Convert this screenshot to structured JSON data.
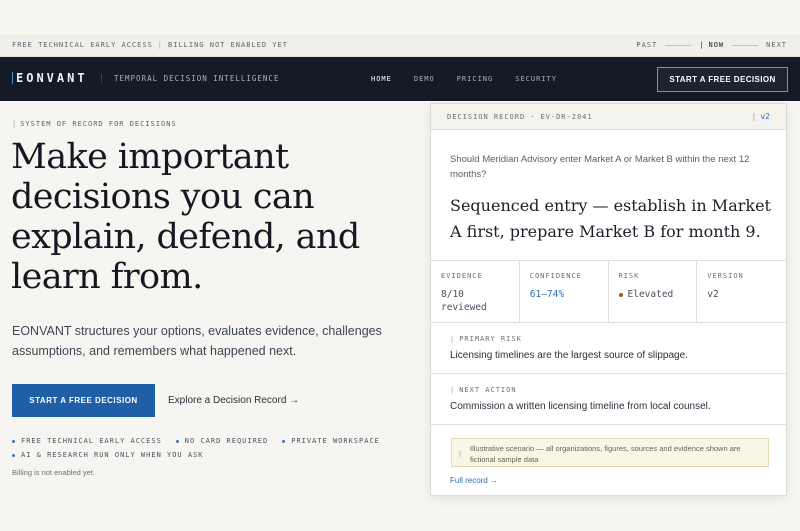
{
  "strip": {
    "left_items": [
      "FREE TECHNICAL EARLY ACCESS",
      "BILLING NOT ENABLED YET"
    ],
    "separator": "|",
    "timeline": {
      "past": "PAST",
      "now": "NOW",
      "next": "NEXT",
      "now_marker": "|"
    }
  },
  "nav": {
    "logo": "EONVANT",
    "tagline": "TEMPORAL DECISION INTELLIGENCE",
    "links": [
      "HOME",
      "DEMO",
      "PRICING",
      "SECURITY"
    ],
    "active_link": "HOME",
    "cta": "START A FREE DECISION"
  },
  "hero": {
    "eyebrow_marker": "|",
    "eyebrow": "SYSTEM OF RECORD FOR DECISIONS",
    "headline_lines": [
      "Make important",
      "decisions you can",
      "explain, defend, and",
      "learn from."
    ],
    "lede_lines": [
      "EONVANT structures your options, evaluates evidence, challenges",
      "assumptions, and remembers what happened next."
    ],
    "cta_primary": "START A FREE DECISION",
    "cta_secondary": "Explore a Decision Record →",
    "bullets_row1": [
      "FREE TECHNICAL EARLY ACCESS",
      "NO CARD REQUIRED",
      "PRIVATE WORKSPACE"
    ],
    "bullets_row2": [
      "AI & RESEARCH RUN ONLY WHEN YOU ASK"
    ],
    "billing_note": "Billing is not enabled yet."
  },
  "record": {
    "label": "DECISION RECORD",
    "separator": "·",
    "id": "EV-DR-2041",
    "version_marker": "|",
    "version_badge": "v2",
    "question": "Should Meridian Advisory enter Market A or Market B within the next 12 months?",
    "answer": "Sequenced entry — establish in Market A first, prepare Market B for month 9.",
    "stats": {
      "evidence": {
        "label": "EVIDENCE",
        "value_line1": "8/10",
        "value_line2": "reviewed"
      },
      "confidence": {
        "label": "CONFIDENCE",
        "value": "61–74%"
      },
      "risk": {
        "label": "RISK",
        "value": "Elevated",
        "color": "#a8522f"
      },
      "version": {
        "label": "VERSION",
        "value": "v2"
      }
    },
    "section_marker": "|",
    "primary_risk": {
      "label": "PRIMARY RISK",
      "text": "Licensing timelines are the largest source of slippage."
    },
    "next_action": {
      "label": "NEXT ACTION",
      "text": "Commission a written licensing timeline from local counsel."
    },
    "disclaimer_marker": "|",
    "disclaimer": "Illustrative scenario — all organizations, figures, sources and evidence shown are fictional sample data",
    "full_record": "Full record →"
  },
  "colors": {
    "accent": "#1f5fa8",
    "nav_bg": "#151b26",
    "page_bg": "#f6f5f1",
    "link_blue": "#2f6fb5"
  }
}
